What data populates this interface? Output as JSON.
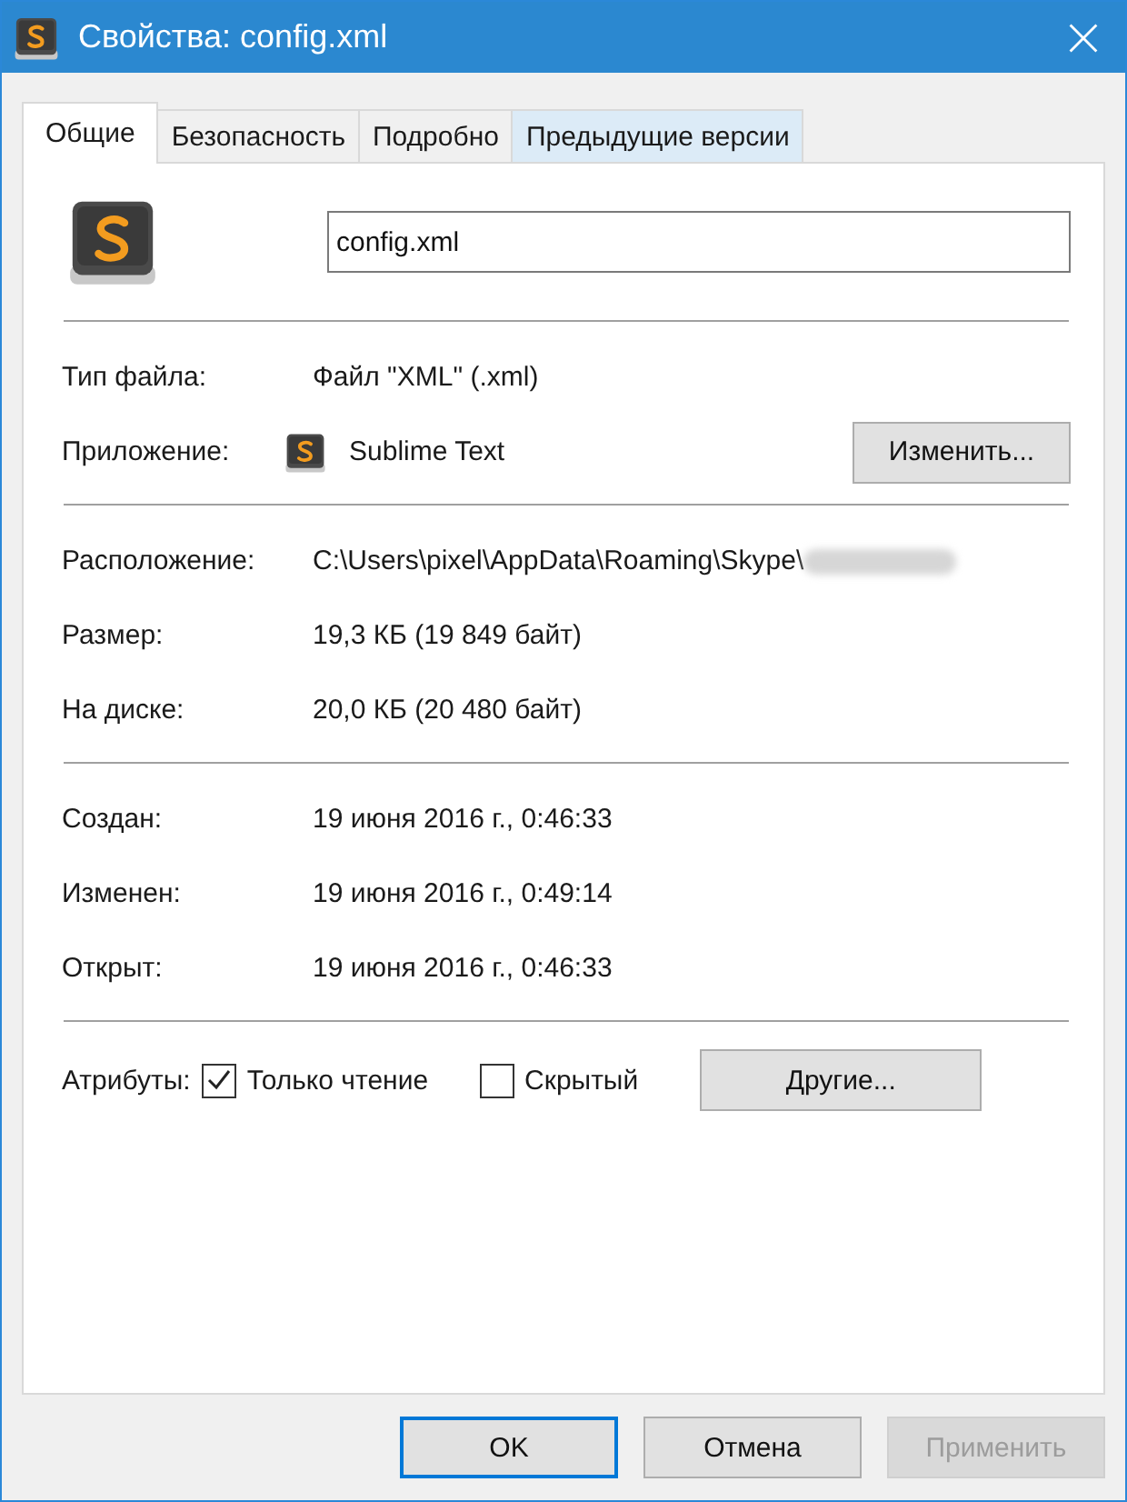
{
  "window": {
    "title": "Свойства: config.xml"
  },
  "tabs": [
    {
      "label": "Общие",
      "selected": true
    },
    {
      "label": "Безопасность",
      "selected": false
    },
    {
      "label": "Подробно",
      "selected": false
    },
    {
      "label": "Предыдущие версии",
      "selected": false
    }
  ],
  "file_name": "config.xml",
  "sections": [
    {
      "rows": [
        {
          "kind": "text",
          "label": "Тип файла:",
          "value": "Файл \"XML\" (.xml)"
        },
        {
          "kind": "app",
          "label": "Приложение:",
          "value": "Sublime Text",
          "button": "Изменить..."
        }
      ]
    },
    {
      "rows": [
        {
          "kind": "path",
          "label": "Расположение:",
          "value": "C:\\Users\\pixel\\AppData\\Roaming\\Skype\\"
        },
        {
          "kind": "text",
          "label": "Размер:",
          "value": "19,3 КБ (19 849 байт)"
        },
        {
          "kind": "text",
          "label": "На диске:",
          "value": "20,0 КБ (20 480 байт)"
        }
      ]
    },
    {
      "rows": [
        {
          "kind": "text",
          "label": "Создан:",
          "value": "19 июня 2016 г., 0:46:33"
        },
        {
          "kind": "text",
          "label": "Изменен:",
          "value": "19 июня 2016 г., 0:49:14"
        },
        {
          "kind": "text",
          "label": "Открыт:",
          "value": "19 июня 2016 г., 0:46:33"
        }
      ]
    }
  ],
  "attributes": {
    "label": "Атрибуты:",
    "options": [
      {
        "label": "Только чтение",
        "checked": true
      },
      {
        "label": "Скрытый",
        "checked": false
      }
    ],
    "button": "Другие..."
  },
  "buttons": [
    {
      "label": "OK",
      "default": true,
      "disabled": false
    },
    {
      "label": "Отмена",
      "default": false,
      "disabled": false
    },
    {
      "label": "Применить",
      "default": false,
      "disabled": true
    }
  ]
}
